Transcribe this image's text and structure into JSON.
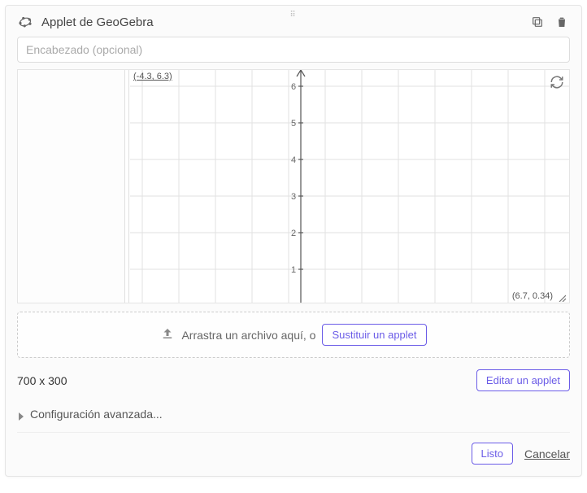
{
  "header": {
    "title": "Applet de GeoGebra"
  },
  "heading_input": {
    "placeholder": "Encabezado (opcional)",
    "value": ""
  },
  "graph": {
    "top_left_coord": "(-4.3, 6.3)",
    "bottom_right_coord": "(6.7, 0.34)",
    "y_ticks": [
      "6",
      "5",
      "4",
      "3",
      "2",
      "1"
    ]
  },
  "upload": {
    "drag_text": "Arrastra un archivo aquí, o",
    "replace_button": "Sustituir un applet"
  },
  "dimensions": "700 x 300",
  "edit_button": "Editar un applet",
  "advanced_label": "Configuración avanzada...",
  "footer": {
    "done": "Listo",
    "cancel": "Cancelar"
  }
}
